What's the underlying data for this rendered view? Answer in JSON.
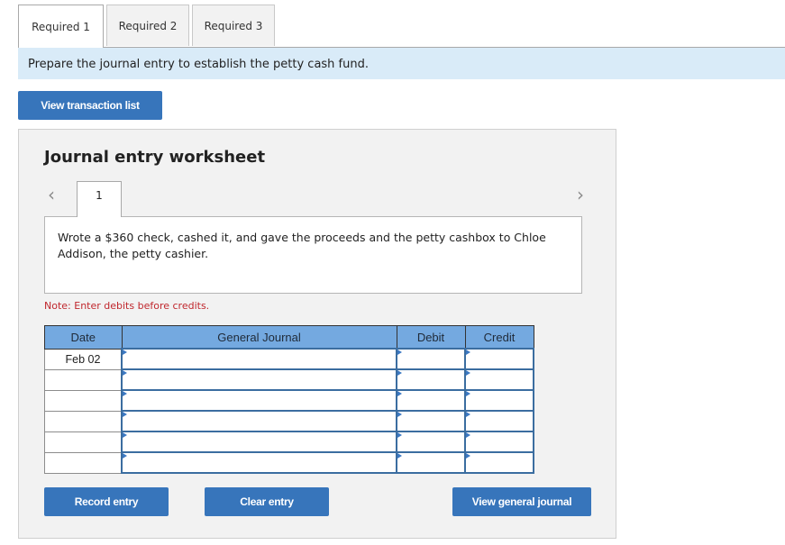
{
  "tabs": [
    {
      "label": "Required 1",
      "active": true
    },
    {
      "label": "Required 2",
      "active": false
    },
    {
      "label": "Required 3",
      "active": false
    }
  ],
  "instruction": "Prepare the journal entry to establish the petty cash fund.",
  "buttons": {
    "view_transaction_list": "View transaction list",
    "record_entry": "Record entry",
    "clear_entry": "Clear entry",
    "view_general_journal": "View general journal"
  },
  "worksheet": {
    "title": "Journal entry worksheet",
    "nav_prev_icon": "chevron-left",
    "nav_next_icon": "chevron-right",
    "entry_number": "1",
    "description": "Wrote a $360 check, cashed it, and gave the proceeds and the petty cashbox to Chloe Addison, the petty cashier.",
    "note": "Note: Enter debits before credits."
  },
  "journal": {
    "headers": {
      "date": "Date",
      "general_journal": "General Journal",
      "debit": "Debit",
      "credit": "Credit"
    },
    "rows": [
      {
        "date": "Feb 02",
        "account": "",
        "debit": "",
        "credit": ""
      },
      {
        "date": "",
        "account": "",
        "debit": "",
        "credit": ""
      },
      {
        "date": "",
        "account": "",
        "debit": "",
        "credit": ""
      },
      {
        "date": "",
        "account": "",
        "debit": "",
        "credit": ""
      },
      {
        "date": "",
        "account": "",
        "debit": "",
        "credit": ""
      },
      {
        "date": "",
        "account": "",
        "debit": "",
        "credit": ""
      }
    ]
  },
  "colors": {
    "button_blue": "#3775bb",
    "header_blue": "#74a9e0",
    "instruction_bg": "#d9ebf8",
    "note_red": "#c0272d"
  }
}
